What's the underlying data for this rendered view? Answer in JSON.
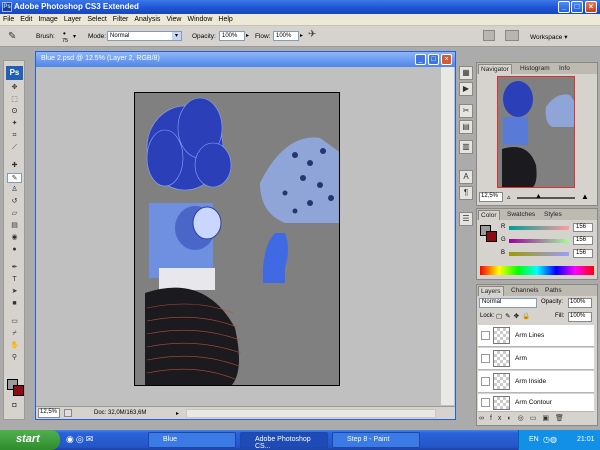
{
  "app": {
    "title": "Adobe Photoshop CS3 Extended"
  },
  "menu": [
    "File",
    "Edit",
    "Image",
    "Layer",
    "Select",
    "Filter",
    "Analysis",
    "View",
    "Window",
    "Help"
  ],
  "options": {
    "brush_label": "Brush:",
    "brush_size": "75",
    "mode_label": "Mode:",
    "mode_value": "Normal",
    "opacity_label": "Opacity:",
    "opacity_value": "100%",
    "flow_label": "Flow:",
    "flow_value": "100%",
    "workspace_label": "Workspace ▾"
  },
  "document": {
    "title": "Blue 2.psd @ 12.5% (Layer 2, RGB/8)",
    "zoom": "12,5%",
    "doc_info": "Doc: 32,0M/163,6M"
  },
  "navigator": {
    "tabs": [
      "Navigator",
      "Histogram",
      "Info"
    ],
    "zoom": "12,5%"
  },
  "color": {
    "tabs": [
      "Color",
      "Swatches",
      "Styles"
    ],
    "channels": [
      {
        "name": "R",
        "value": "156"
      },
      {
        "name": "G",
        "value": "156"
      },
      {
        "name": "B",
        "value": "156"
      }
    ]
  },
  "layers": {
    "tabs": [
      "Layers",
      "Channels",
      "Paths"
    ],
    "blend_mode": "Normal",
    "opacity_label": "Opacity:",
    "opacity_value": "100%",
    "lock_label": "Lock:",
    "fill_label": "Fill:",
    "fill_value": "100%",
    "items": [
      "Arm Lines",
      "Arm",
      "Arm Inside",
      "Arm Contour"
    ]
  },
  "taskbar": {
    "start": "start",
    "tasks": [
      "Blue",
      "Adobe Photoshop CS...",
      "Step 8 - Paint"
    ],
    "lang": "EN",
    "time": "21:01"
  },
  "colors": {
    "accent": "#2460d8",
    "canvas_bg": "#808080",
    "fg_swatch": "#9c9c9c",
    "bg_swatch": "#8b0c14"
  }
}
